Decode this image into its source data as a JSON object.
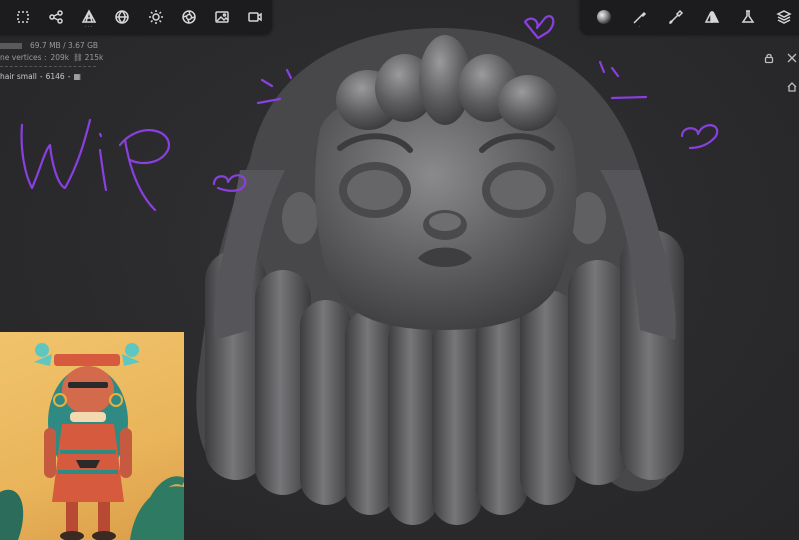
{
  "stats": {
    "memory": "69.7 MB / 3.67 GB",
    "vertices_label": "ne vertices :",
    "vertices": "209k",
    "faces": "215k",
    "object_name": "hair small",
    "object_count": "6146"
  },
  "toolbar_left": {
    "items": [
      "sculpt-icon",
      "share-graph-icon",
      "topology-icon",
      "globe-icon",
      "sun-icon",
      "aperture-icon",
      "image-icon",
      "video-icon"
    ]
  },
  "toolbar_right": {
    "items": [
      "material-sphere-icon",
      "brush-icon",
      "paint-brush-icon",
      "symmetry-icon",
      "flask-icon",
      "layers-icon"
    ]
  },
  "annotation": {
    "handwriting": "Wip",
    "color": "#8a3fe0"
  },
  "model": {
    "base_color": "#5c5c5e",
    "highlight_color": "#8a8a8c"
  },
  "reference": {
    "background": "#efc16a",
    "accent_teal": "#2f8a84",
    "accent_red": "#d65a3e"
  }
}
